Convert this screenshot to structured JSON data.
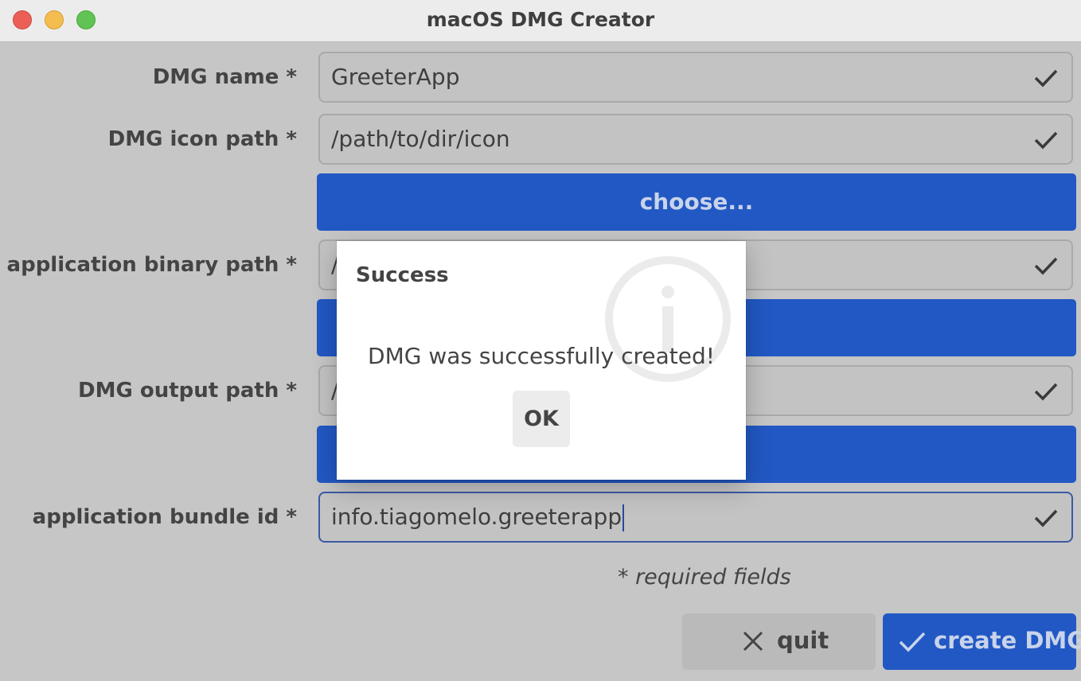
{
  "window": {
    "title": "macOS DMG Creator"
  },
  "form": {
    "dmg_name": {
      "label": "DMG name *",
      "value": "GreeterApp"
    },
    "dmg_icon_path": {
      "label": "DMG icon path *",
      "value": "/path/to/dir/icon",
      "choose_label": "choose..."
    },
    "app_binary_path": {
      "label": "application binary path *",
      "value": "/"
    },
    "dmg_output_path": {
      "label": "DMG output path *",
      "value": "/"
    },
    "bundle_id": {
      "label": "application bundle id *",
      "value": "info.tiagomelo.greeterapp"
    },
    "required_note": "* required fields"
  },
  "buttons": {
    "quit_label": "quit",
    "create_label": "create DMG"
  },
  "dialog": {
    "title": "Success",
    "message": "DMG was successfully created!",
    "ok_label": "OK"
  },
  "colors": {
    "accent": "#2258c4",
    "background": "#c6c6c6"
  }
}
